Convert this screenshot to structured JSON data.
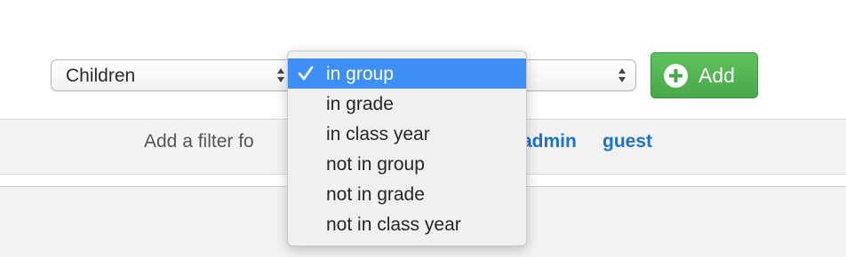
{
  "toolbar": {
    "field_select": {
      "value": "Children"
    },
    "condition_select": {
      "value": ""
    },
    "add_button": {
      "label": "Add"
    }
  },
  "dropdown": {
    "selected_index": 0,
    "options": [
      "in group",
      "in grade",
      "in class year",
      "not in group",
      "not in grade",
      "not in class year"
    ]
  },
  "filter_bar": {
    "text": "Add a filter fo",
    "links": [
      "admin",
      "guest"
    ]
  },
  "colors": {
    "accent_blue": "#3d8ff7",
    "add_green": "#47a847",
    "link_blue": "#1a73c8"
  }
}
